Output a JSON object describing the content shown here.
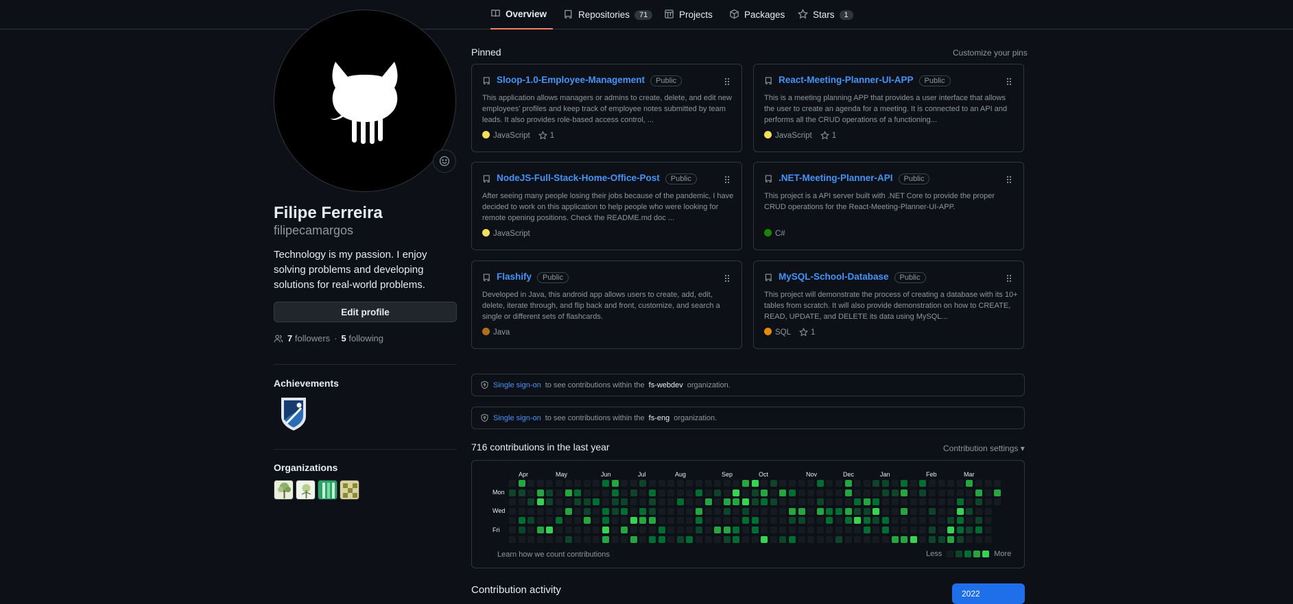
{
  "tabs": [
    {
      "label": "Overview",
      "icon": "book-icon",
      "selected": true
    },
    {
      "label": "Repositories",
      "icon": "repo-icon",
      "count": "71"
    },
    {
      "label": "Projects",
      "icon": "project-icon"
    },
    {
      "label": "Packages",
      "icon": "package-icon"
    },
    {
      "label": "Stars",
      "icon": "star-icon",
      "count": "1"
    }
  ],
  "profile": {
    "name": "Filipe Ferreira",
    "username": "filipecamargos",
    "bio": "Technology is my passion. I enjoy solving problems and developing solutions for real-world problems.",
    "edit_label": "Edit profile",
    "followers_count": "7",
    "followers_label": "followers",
    "separator": "·",
    "following_count": "5",
    "following_label": "following",
    "achievements_title": "Achievements",
    "organizations_title": "Organizations"
  },
  "pinned": {
    "title": "Pinned",
    "customize": "Customize your pins",
    "cards": [
      {
        "name": "Sloop-1.0-Employee-Management",
        "visibility": "Public",
        "description": "This application allows managers or admins to create, delete, and edit new employees' profiles and keep track of employee notes submitted by team leads. It also provides role-based access control, ...",
        "language": "JavaScript",
        "lang_color": "#f1e05a",
        "stars": "1"
      },
      {
        "name": "React-Meeting-Planner-UI-APP",
        "visibility": "Public",
        "description": "This is a meeting planning APP that provides a user interface that allows the user to create an agenda for a meeting. It is connected to an API and performs all the CRUD operations of a functioning...",
        "language": "JavaScript",
        "lang_color": "#f1e05a",
        "stars": "1"
      },
      {
        "name": "NodeJS-Full-Stack-Home-Office-Post",
        "visibility": "Public",
        "description": "After seeing many people losing their jobs because of the pandemic, I have decided to work on this application to help people who were looking for remote opening positions. Check the README.md doc ...",
        "language": "JavaScript",
        "lang_color": "#f1e05a",
        "stars": ""
      },
      {
        "name": ".NET-Meeting-Planner-API",
        "visibility": "Public",
        "description": "This project is a API server built with .NET Core to provide the proper CRUD operations for the React-Meeting-Planner-UI-APP.",
        "language": "C#",
        "lang_color": "#178600",
        "stars": ""
      },
      {
        "name": "Flashify",
        "visibility": "Public",
        "description": "Developed in Java, this android app allows users to create, add, edit, delete, iterate through, and flip back and front, customize, and search a single or different sets of flashcards.",
        "language": "Java",
        "lang_color": "#b07219",
        "stars": ""
      },
      {
        "name": "MySQL-School-Database",
        "visibility": "Public",
        "description": "This project will demonstrate the process of creating a database with its 10+ tables from scratch. It will also provide demonstration on how to CREATE, READ, UPDATE, and DELETE its data using MySQL...",
        "language": "SQL",
        "lang_color": "#e38c00",
        "stars": "1"
      }
    ]
  },
  "sso": [
    {
      "link": "Single sign-on",
      "before": "to see contributions within the",
      "org": "fs-webdev",
      "after": "organization."
    },
    {
      "link": "Single sign-on",
      "before": "to see contributions within the",
      "org": "fs-eng",
      "after": "organization."
    }
  ],
  "contributions": {
    "title": "716 contributions in the last year",
    "settings": "Contribution settings",
    "months": [
      "Apr",
      "May",
      "Jun",
      "Jul",
      "Aug",
      "Sep",
      "Oct",
      "Nov",
      "Dec",
      "Jan",
      "Feb",
      "Mar"
    ],
    "days": [
      "Mon",
      "Wed",
      "Fri"
    ],
    "learn": "Learn how we count contributions",
    "less": "Less",
    "more": "More",
    "colors": [
      "#161b22",
      "#0e4429",
      "#006d32",
      "#26a641",
      "#39d353"
    ]
  },
  "activity": {
    "title": "Contribution activity",
    "year": "2022"
  }
}
